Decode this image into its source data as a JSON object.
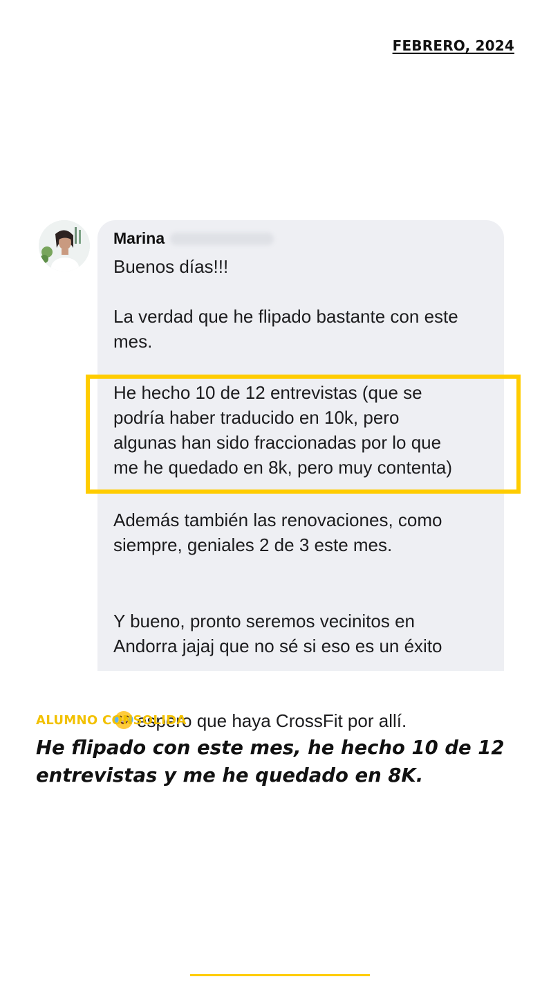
{
  "date": "FEBRERO, 2024",
  "chat": {
    "sender_name": "Marina",
    "messages": [
      "Buenos días!!!",
      "La verdad que he flipado bastante con este\nmes.",
      "He hecho 10 de 12 entrevistas (que se\npodría haber traducido en 10k, pero\nalgunas han sido fraccionadas por lo que\nme he quedado en 8k, pero muy contenta)",
      "Además también las renovaciones, como\nsiempre, geniales 2 de 3 este mes.",
      "Y bueno, pronto seremos vecinitos en\nAndorra jajaj que no sé si eso es un éxito"
    ],
    "last_line_after_emoji": "espero que haya CrossFit por allí.",
    "emoji": "face-with-tears-of-joy-icon"
  },
  "testimonial": {
    "label": "ALUMNO CONSOLIDA",
    "quote": "He flipado con este mes, he hecho 10 de 12 entrevistas y me he quedado en 8K."
  },
  "colors": {
    "accent": "#ffcc00",
    "bubble": "#eeeff3"
  }
}
